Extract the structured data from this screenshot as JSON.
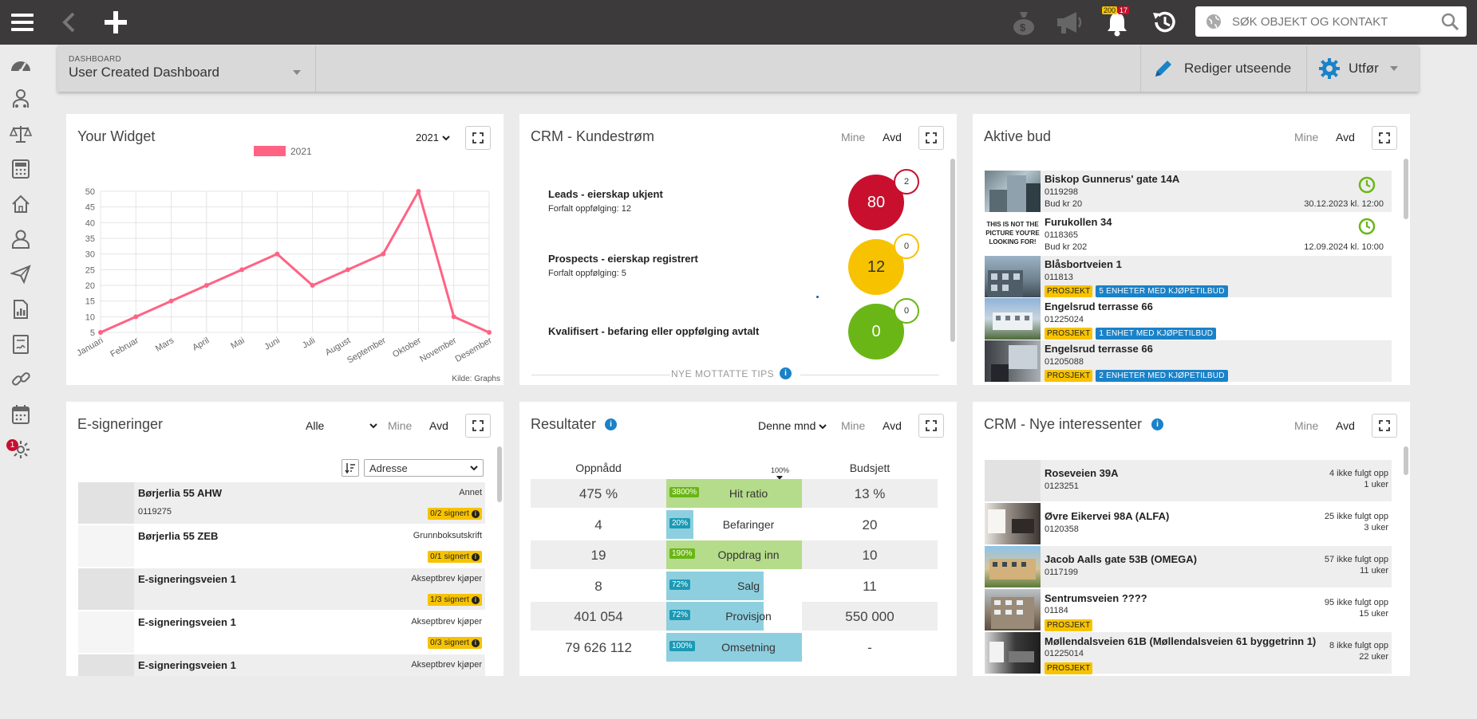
{
  "topbar": {
    "notif_count_a": "200",
    "notif_count_b": "17",
    "search_placeholder": "SØK OBJEKT OG KONTAKT",
    "icons": [
      "menu-icon",
      "back-icon",
      "plus-icon",
      "money-bag-icon",
      "megaphone-icon",
      "bell-icon",
      "history-icon",
      "globe-icon",
      "search-icon"
    ]
  },
  "sidebar": {
    "icons": [
      "speedometer-icon",
      "people-icon",
      "scale-icon",
      "calculator-icon",
      "home-icon",
      "person-icon",
      "paper-plane-icon",
      "report-icon",
      "contract-icon",
      "link-icon",
      "calendar-icon",
      "settings-icon"
    ],
    "settings_badge": "1"
  },
  "subbar": {
    "dashboard_label": "DASHBOARD",
    "dashboard_name": "User Created Dashboard",
    "edit_label": "Rediger utseende",
    "action_label": "Utfør"
  },
  "widget": {
    "title": "Your Widget",
    "year": "2021",
    "source": "Kilde: Graphs"
  },
  "chart_data": {
    "type": "line",
    "title": "",
    "categories": [
      "Januari",
      "Februar",
      "Mars",
      "April",
      "Mai",
      "Juni",
      "Juli",
      "August",
      "September",
      "Oktober",
      "November",
      "Desember"
    ],
    "series": [
      {
        "name": "2021",
        "values": [
          5,
          10,
          15,
          20,
          25,
          30,
          20,
          25,
          30,
          50,
          10,
          5
        ],
        "color": "#ff6384"
      }
    ],
    "ylim": [
      5,
      50
    ],
    "yticks": [
      5,
      10,
      15,
      20,
      25,
      30,
      35,
      40,
      45,
      50
    ],
    "legend": "top",
    "grid": true
  },
  "crm": {
    "title": "CRM - Kundestrøm",
    "mine": "Mine",
    "avd": "Avd",
    "rows": [
      {
        "label": "Leads - eierskap ukjent",
        "sub": "Forfalt oppfølging: 12",
        "value": "80",
        "badge": "2",
        "color": "#c8102e"
      },
      {
        "label": "Prospects - eierskap registrert",
        "sub": "Forfalt oppfølging: 5",
        "value": "12",
        "badge": "0",
        "color": "#f7c300"
      },
      {
        "label": "Kvalifisert - befaring eller oppfølging avtalt",
        "sub": "",
        "value": "0",
        "badge": "0",
        "color": "#6ab616"
      }
    ],
    "footer": "NYE MOTTATTE TIPS"
  },
  "bud": {
    "title": "Aktive bud",
    "mine": "Mine",
    "avd": "Avd",
    "items": [
      {
        "name": "Biskop Gunnerus' gate 14A",
        "id": "0119298",
        "line3": "Bud kr 20",
        "date": "30.12.2023 kl. 12:00",
        "tag1": "",
        "tag2": ""
      },
      {
        "name": "Furukollen 34",
        "id": "0118365",
        "line3": "Bud kr 202",
        "date": "12.09.2024 kl. 10:00",
        "tag1": "",
        "tag2": "",
        "thumb_text": "THIS IS NOT THE PICTURE YOU'RE LOOKING FOR!"
      },
      {
        "name": "Blåsbortveien 1",
        "id": "011813",
        "line3": "",
        "date": "",
        "tag1": "PROSJEKT",
        "tag2": "5 ENHETER MED KJØPETILBUD"
      },
      {
        "name": "Engelsrud terrasse 66",
        "id": "01225024",
        "line3": "",
        "date": "",
        "tag1": "PROSJEKT",
        "tag2": "1 ENHET MED KJØPETILBUD"
      },
      {
        "name": "Engelsrud terrasse 66",
        "id": "01205088",
        "line3": "",
        "date": "",
        "tag1": "PROSJEKT",
        "tag2": "2 ENHETER MED KJØPETILBUD"
      }
    ]
  },
  "esign": {
    "title": "E-signeringer",
    "filter": "Alle",
    "mine": "Mine",
    "avd": "Avd",
    "sort": "Adresse",
    "items": [
      {
        "name": "Børjerlia 55 AHW",
        "id": "0119275",
        "type": "Annet",
        "status": "0/2 signert"
      },
      {
        "name": "Børjerlia 55 ZEB",
        "id": "",
        "type": "Grunnboksutskrift",
        "status": "0/1 signert"
      },
      {
        "name": "E-signeringsveien 1",
        "id": "",
        "type": "Akseptbrev kjøper",
        "status": "1/3 signert"
      },
      {
        "name": "E-signeringsveien 1",
        "id": "",
        "type": "Akseptbrev kjøper",
        "status": "0/3 signert"
      },
      {
        "name": "E-signeringsveien 1",
        "id": "",
        "type": "Akseptbrev kjøper",
        "status": ""
      }
    ]
  },
  "results": {
    "title": "Resultater",
    "period": "Denne mnd",
    "mine": "Mine",
    "avd": "Avd",
    "col_achieved": "Oppnådd",
    "col_budget": "Budsjett",
    "marker": "100%",
    "rows": [
      {
        "achieved": "475 %",
        "pct": "3800%",
        "label": "Hit ratio",
        "budget": "13 %",
        "fill": 1.0,
        "color": "#b5dc8a",
        "pctcolor": "#6ab616"
      },
      {
        "achieved": "4",
        "pct": "20%",
        "label": "Befaringer",
        "budget": "20",
        "fill": 0.2,
        "color": "#8ecfdf",
        "pctcolor": "#1a9ab5"
      },
      {
        "achieved": "19",
        "pct": "190%",
        "label": "Oppdrag inn",
        "budget": "10",
        "fill": 1.0,
        "color": "#b5dc8a",
        "pctcolor": "#6ab616"
      },
      {
        "achieved": "8",
        "pct": "72%",
        "label": "Salg",
        "budget": "11",
        "fill": 0.72,
        "color": "#8ecfdf",
        "pctcolor": "#1a9ab5"
      },
      {
        "achieved": "401 054",
        "pct": "72%",
        "label": "Provisjon",
        "budget": "550 000",
        "fill": 0.72,
        "color": "#8ecfdf",
        "pctcolor": "#1a9ab5"
      },
      {
        "achieved": "79 626 112",
        "pct": "100%",
        "label": "Omsetning",
        "budget": "-",
        "fill": 1.0,
        "color": "#8ecfdf",
        "pctcolor": "#1a9ab5"
      }
    ]
  },
  "interest": {
    "title": "CRM - Nye interessenter",
    "mine": "Mine",
    "avd": "Avd",
    "items": [
      {
        "name": "Roseveien 39A",
        "id": "0123251",
        "count": "4 ikke fulgt opp",
        "age": "1 uker",
        "tag": ""
      },
      {
        "name": "Øvre Eikervei 98A (ALFA)",
        "id": "0120358",
        "count": "25 ikke fulgt opp",
        "age": "3 uker",
        "tag": ""
      },
      {
        "name": "Jacob Aalls gate 53B (OMEGA)",
        "id": "0117199",
        "count": "57 ikke fulgt opp",
        "age": "11 uker",
        "tag": ""
      },
      {
        "name": "Sentrumsveien ????",
        "id": "01184",
        "count": "95 ikke fulgt opp",
        "age": "15 uker",
        "tag": "PROSJEKT"
      },
      {
        "name": "Møllendalsveien 61B (Møllendalsveien 61 byggetrinn 1)",
        "id": "01225014",
        "count": "8 ikke fulgt opp",
        "age": "22 uker",
        "tag": "PROSJEKT"
      }
    ]
  }
}
